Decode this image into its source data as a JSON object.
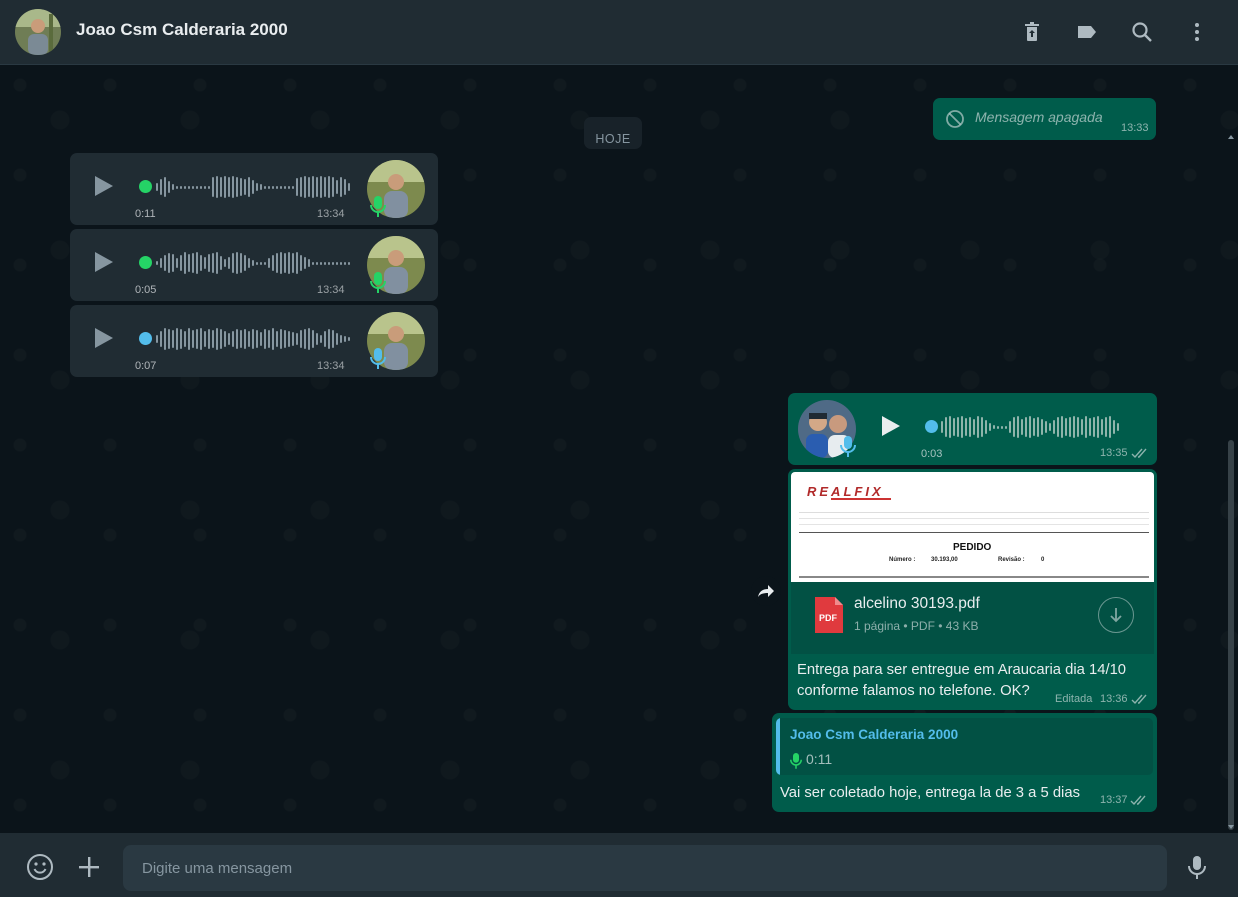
{
  "header": {
    "contact_name": "Joao Csm Calderaria 2000",
    "icons": [
      "delete-icon",
      "label-icon",
      "search-icon",
      "menu-icon"
    ]
  },
  "chat": {
    "date_chip": "HOJE",
    "deleted_message": {
      "text": "Mensagem apagada",
      "time": "13:33"
    },
    "incoming_voice": [
      {
        "duration": "0:11",
        "time": "13:34",
        "dot_color": "#25d366",
        "mic_color": "#25d366"
      },
      {
        "duration": "0:05",
        "time": "13:34",
        "dot_color": "#25d366",
        "mic_color": "#25d366"
      },
      {
        "duration": "0:07",
        "time": "13:34",
        "dot_color": "#53bdeb",
        "mic_color": "#53bdeb"
      }
    ],
    "outgoing_voice": {
      "duration": "0:03",
      "time": "13:35",
      "mic_color": "#53bdeb"
    },
    "document": {
      "preview": {
        "brand": "REALFIX",
        "heading": "PEDIDO",
        "numero_label": "Número :",
        "numero": "30.193,00",
        "revisao_label": "Revisão :",
        "revisao": "0"
      },
      "icon_label": "PDF",
      "file_name": "alcelino 30193.pdf",
      "meta": "1 página • PDF • 43 KB",
      "caption_line1": "Entrega para ser entregue em Araucaria dia 14/10",
      "caption_line2": "conforme falamos no telefone. OK?",
      "edited_label": "Editada",
      "time": "13:36"
    },
    "reply": {
      "quoted_name": "Joao Csm Calderaria 2000",
      "quoted_duration": "0:11",
      "text": "Vai ser coletado hoje, entrega la de 3 a 5 dias",
      "time": "13:37"
    }
  },
  "composer": {
    "placeholder": "Digite uma mensagem"
  },
  "colors": {
    "panel": "#202c33",
    "background": "#0b141a",
    "outgoing": "#005c4b",
    "incoming": "#202c33",
    "accent_blue": "#53bdeb",
    "accent_green": "#25d366"
  }
}
